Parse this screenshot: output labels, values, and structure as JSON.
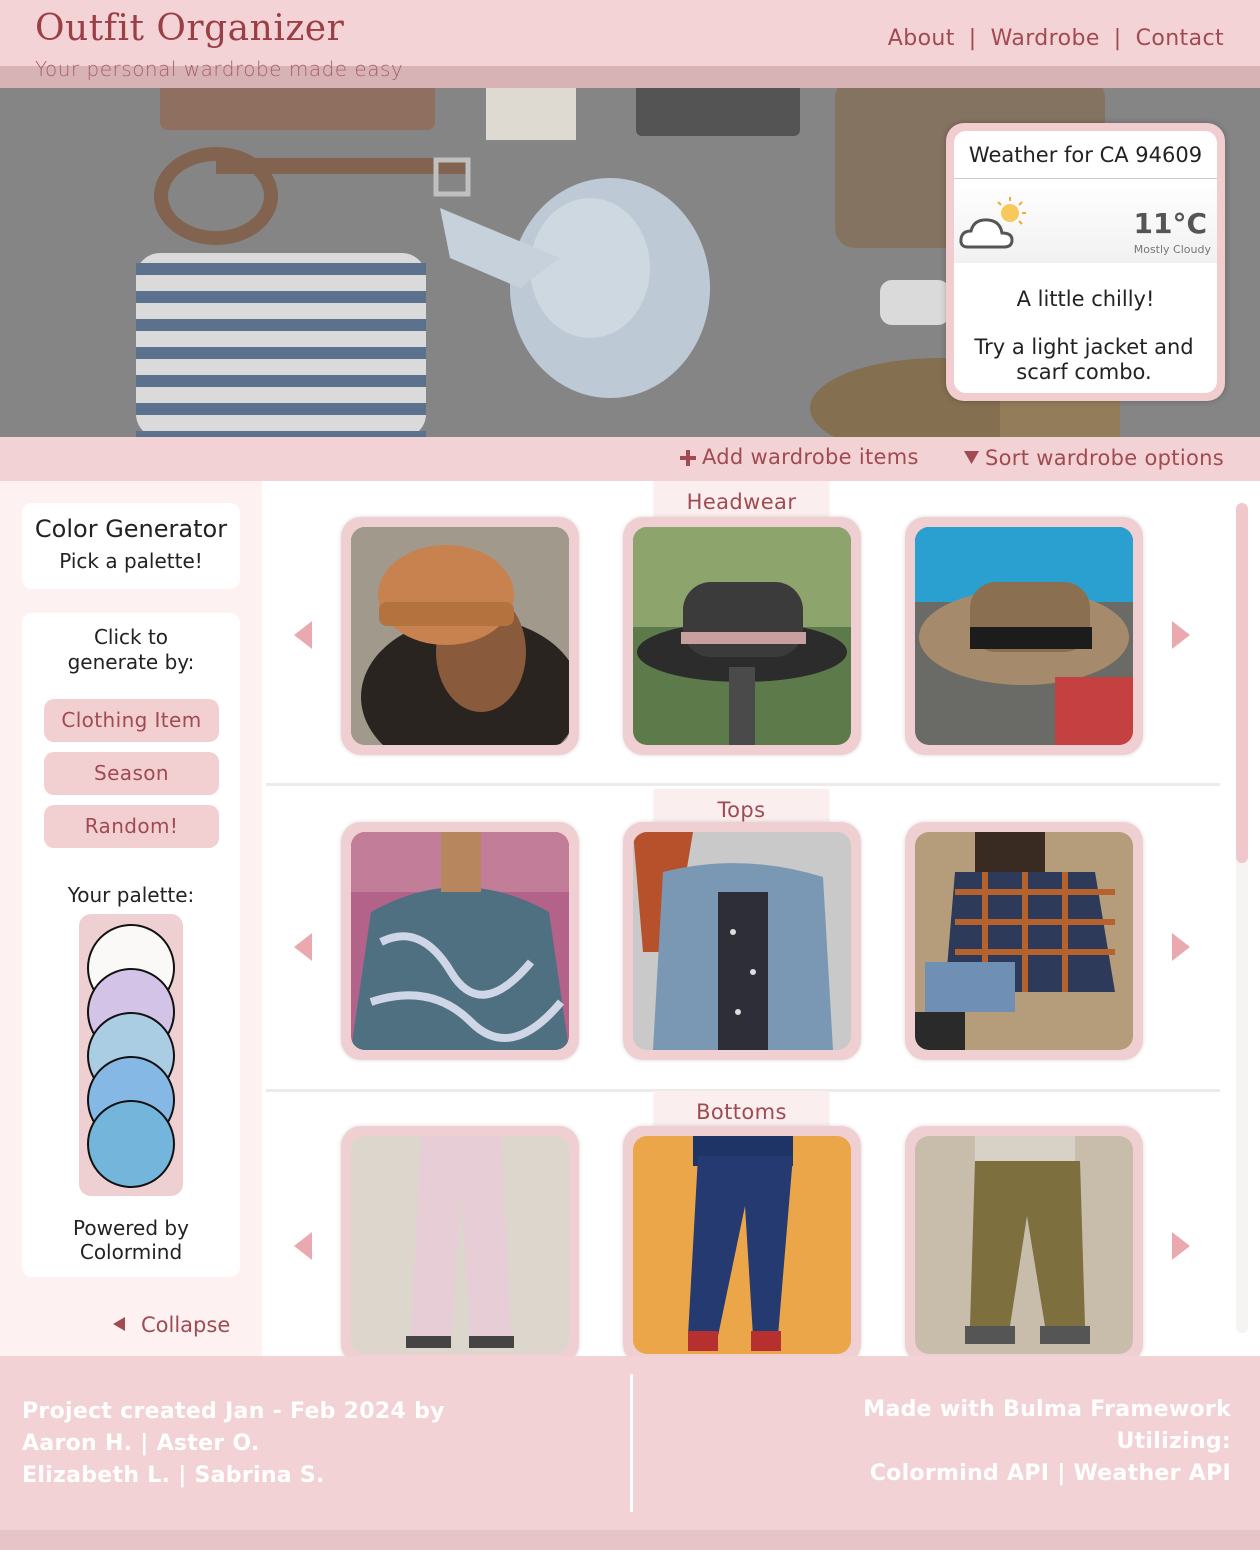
{
  "header": {
    "brand": "Outfit Organizer",
    "tagline": "Your personal wardrobe made easy",
    "nav": [
      "About",
      "Wardrobe",
      "Contact"
    ],
    "separator": "|"
  },
  "weather": {
    "title": "Weather for CA 94609",
    "temperature": "11°C",
    "condition": "Mostly Cloudy",
    "icon": "partly-cloudy-icon",
    "message": "A little chilly!",
    "suggestion": "Try a light jacket and scarf combo."
  },
  "actions": {
    "add": "Add wardrobe items",
    "add_icon": "plus-icon",
    "sort": "Sort wardrobe options",
    "sort_icon": "triangle-down-icon"
  },
  "sidebar": {
    "title": "Color Generator",
    "subtitle": "Pick a palette!",
    "generate_label": "Click to generate by:",
    "buttons": [
      "Clothing Item",
      "Season",
      "Random!"
    ],
    "palette_label": "Your palette:",
    "palette": [
      "#fbf9f8",
      "#d2c3e7",
      "#abcde4",
      "#86b8e6",
      "#74b5dc"
    ],
    "powered_by": "Powered by Colormind",
    "collapse": "Collapse"
  },
  "wardrobe": {
    "sections": [
      {
        "title": "Headwear",
        "items": [
          "orange-beanie",
          "grey-fedora",
          "straw-hat"
        ]
      },
      {
        "title": "Tops",
        "items": [
          "marble-print-blouse",
          "denim-shirt",
          "flannel-shirt"
        ]
      },
      {
        "title": "Bottoms",
        "items": [
          "pink-trousers",
          "navy-jeans",
          "olive-cargo-pants"
        ]
      }
    ]
  },
  "footer": {
    "credits": [
      "Project created Jan - Feb 2024 by",
      "Aaron H. | Aster O.",
      "Elizabeth L. | Sabrina S."
    ],
    "tech": [
      "Made with Bulma Framework",
      "Utilizing:",
      "Colormind API | Weather API"
    ]
  },
  "colors": {
    "accent": "#a04a52",
    "brand": "#9b3f47",
    "pink": "#f2d2d4"
  }
}
